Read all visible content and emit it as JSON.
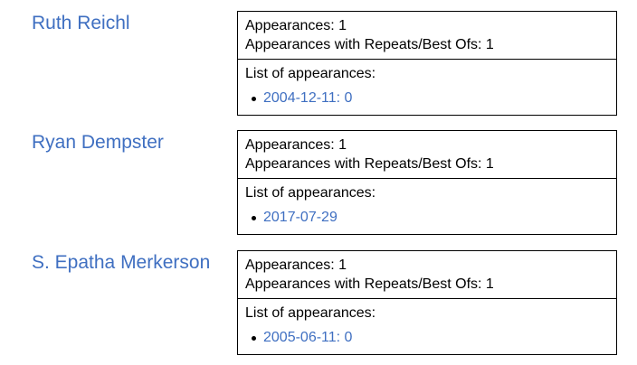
{
  "entries": [
    {
      "name": "Ruth Reichl",
      "appearances": "Appearances: 1",
      "repeats": "Appearances with Repeats/Best Ofs: 1",
      "list_label": "List of appearances:",
      "items": [
        "2004-12-11: 0"
      ]
    },
    {
      "name": "Ryan Dempster",
      "appearances": "Appearances: 1",
      "repeats": "Appearances with Repeats/Best Ofs: 1",
      "list_label": "List of appearances:",
      "items": [
        "2017-07-29"
      ]
    },
    {
      "name": "S. Epatha Merkerson",
      "appearances": "Appearances: 1",
      "repeats": "Appearances with Repeats/Best Ofs: 1",
      "list_label": "List of appearances:",
      "items": [
        "2005-06-11: 0"
      ]
    }
  ],
  "colors": {
    "link": "#3f6fc1",
    "border": "#000000"
  }
}
